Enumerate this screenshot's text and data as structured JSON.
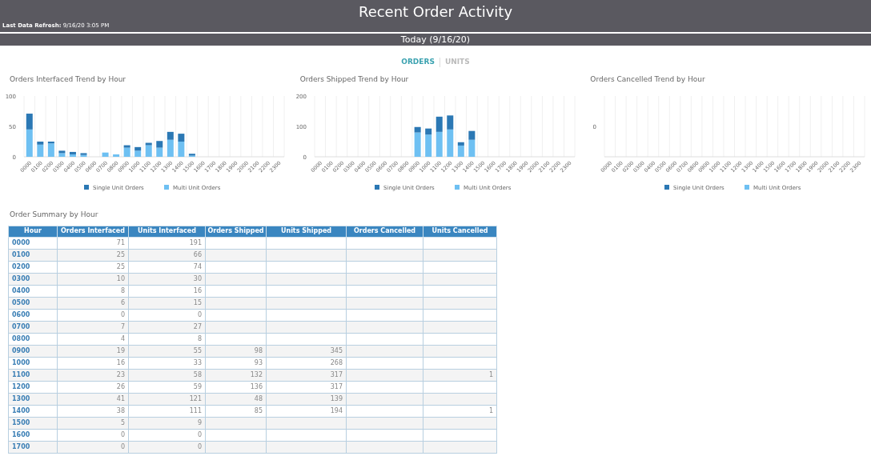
{
  "header": {
    "title": "Recent Order Activity",
    "refresh_label": "Last Data Refresh:",
    "refresh_value": "9/16/20 3:05 PM"
  },
  "date_bar": "Today (9/16/20)",
  "tabs": [
    {
      "label": "ORDERS",
      "selected": true
    },
    {
      "label": "UNITS",
      "selected": false
    }
  ],
  "charts": [
    {
      "chart_data": {
        "type": "bar",
        "stacked": true,
        "title": "Orders Interfaced Trend by Hour",
        "legend": "bottom",
        "categories": [
          "0000",
          "0100",
          "0200",
          "0300",
          "0400",
          "0500",
          "0600",
          "0700",
          "0800",
          "0900",
          "1000",
          "1100",
          "1200",
          "1300",
          "1400",
          "1500",
          "1600",
          "1700",
          "1800",
          "1900",
          "2000",
          "2100",
          "2200",
          "2300"
        ],
        "ylim": [
          0,
          100
        ],
        "yticks": [
          0,
          50,
          100
        ],
        "series": [
          {
            "name": "Single Unit Orders",
            "color": "#2b78b4",
            "values": [
              26,
              5,
              3,
              4,
              4,
              3,
              0,
              0,
              0,
              4,
              6,
              4,
              11,
              13,
              13,
              3,
              null,
              null,
              null,
              null,
              null,
              null,
              null,
              null
            ]
          },
          {
            "name": "Multi Unit Orders",
            "color": "#6ec0f2",
            "values": [
              45,
              20,
              22,
              6,
              4,
              3,
              0,
              7,
              4,
              15,
              10,
              19,
              15,
              28,
              25,
              2,
              null,
              null,
              null,
              null,
              null,
              null,
              null,
              null
            ]
          }
        ]
      }
    },
    {
      "chart_data": {
        "type": "bar",
        "stacked": true,
        "title": "Orders Shipped Trend by Hour",
        "legend": "bottom",
        "categories": [
          "0000",
          "0100",
          "0200",
          "0300",
          "0400",
          "0500",
          "0600",
          "0700",
          "0800",
          "0900",
          "1000",
          "1100",
          "1200",
          "1300",
          "1400",
          "1500",
          "1600",
          "1700",
          "1800",
          "1900",
          "2000",
          "2100",
          "2200",
          "2300"
        ],
        "ylim": [
          0,
          200
        ],
        "yticks": [
          0,
          100,
          200
        ],
        "series": [
          {
            "name": "Single Unit Orders",
            "color": "#2b78b4",
            "values": [
              null,
              null,
              null,
              null,
              null,
              null,
              null,
              null,
              null,
              18,
              20,
              50,
              46,
              11,
              29,
              null,
              null,
              null,
              null,
              null,
              null,
              null,
              null,
              null
            ]
          },
          {
            "name": "Multi Unit Orders",
            "color": "#6ec0f2",
            "values": [
              null,
              null,
              null,
              null,
              null,
              null,
              null,
              null,
              null,
              80,
              73,
              82,
              90,
              37,
              56,
              null,
              null,
              null,
              null,
              null,
              null,
              null,
              null,
              null
            ]
          }
        ]
      }
    },
    {
      "empty_panel": {
        "title": "Orders Cancelled Trend by Hour",
        "axis_label": "0",
        "hour_labels": [
          "0000",
          "0100",
          "0200",
          "0300",
          "0400",
          "0500",
          "0600",
          "0700",
          "0800",
          "0900",
          "1000",
          "1100",
          "1200",
          "1300",
          "1400",
          "1500",
          "1600",
          "1700",
          "1800",
          "1900",
          "2000",
          "2100",
          "2200",
          "2300"
        ],
        "legend": [
          {
            "name": "Single Unit Orders",
            "color": "#2b78b4"
          },
          {
            "name": "Multi Unit Orders",
            "color": "#6ec0f2"
          }
        ]
      }
    }
  ],
  "table": {
    "title": "Order Summary by Hour",
    "columns": [
      "Hour",
      "Orders Interfaced",
      "Units Interfaced",
      "Orders Shipped",
      "Units Shipped",
      "Orders Cancelled",
      "Units Cancelled"
    ],
    "rows": [
      [
        "0000",
        "71",
        "191",
        null,
        null,
        null,
        null
      ],
      [
        "0100",
        "25",
        "66",
        null,
        null,
        null,
        null
      ],
      [
        "0200",
        "25",
        "74",
        null,
        null,
        null,
        null
      ],
      [
        "0300",
        "10",
        "30",
        null,
        null,
        null,
        null
      ],
      [
        "0400",
        "8",
        "16",
        null,
        null,
        null,
        null
      ],
      [
        "0500",
        "6",
        "15",
        null,
        null,
        null,
        null
      ],
      [
        "0600",
        "0",
        "0",
        null,
        null,
        null,
        null
      ],
      [
        "0700",
        "7",
        "27",
        null,
        null,
        null,
        null
      ],
      [
        "0800",
        "4",
        "8",
        null,
        null,
        null,
        null
      ],
      [
        "0900",
        "19",
        "55",
        "98",
        "345",
        null,
        null
      ],
      [
        "1000",
        "16",
        "33",
        "93",
        "268",
        null,
        null
      ],
      [
        "1100",
        "23",
        "58",
        "132",
        "317",
        null,
        "1"
      ],
      [
        "1200",
        "26",
        "59",
        "136",
        "317",
        null,
        null
      ],
      [
        "1300",
        "41",
        "121",
        "48",
        "139",
        null,
        null
      ],
      [
        "1400",
        "38",
        "111",
        "85",
        "194",
        null,
        "1"
      ],
      [
        "1500",
        "5",
        "9",
        null,
        null,
        null,
        null
      ],
      [
        "1600",
        "0",
        "0",
        null,
        null,
        null,
        null
      ],
      [
        "1700",
        "0",
        "0",
        null,
        null,
        null,
        null
      ]
    ]
  }
}
